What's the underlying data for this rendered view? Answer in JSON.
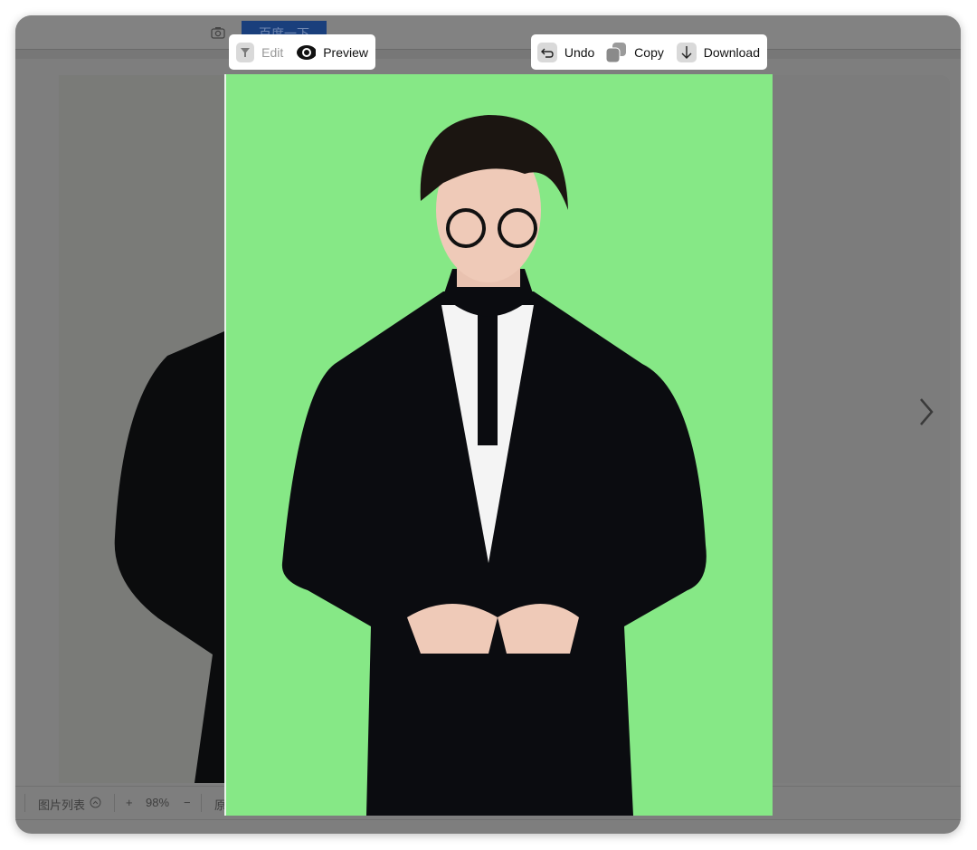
{
  "search": {
    "button_label": "百度一下"
  },
  "toolbar_left": {
    "edit_label": "Edit",
    "preview_label": "Preview"
  },
  "toolbar_right": {
    "undo_label": "Undo",
    "copy_label": "Copy",
    "download_label": "Download"
  },
  "bottom_bar": {
    "image_list_label": "图片列表",
    "zoom_in": "+",
    "zoom_level": "98%",
    "zoom_out": "−",
    "original_label": "原"
  },
  "colors": {
    "background_green": "#86e886",
    "overlay": "#7e7e7e"
  }
}
